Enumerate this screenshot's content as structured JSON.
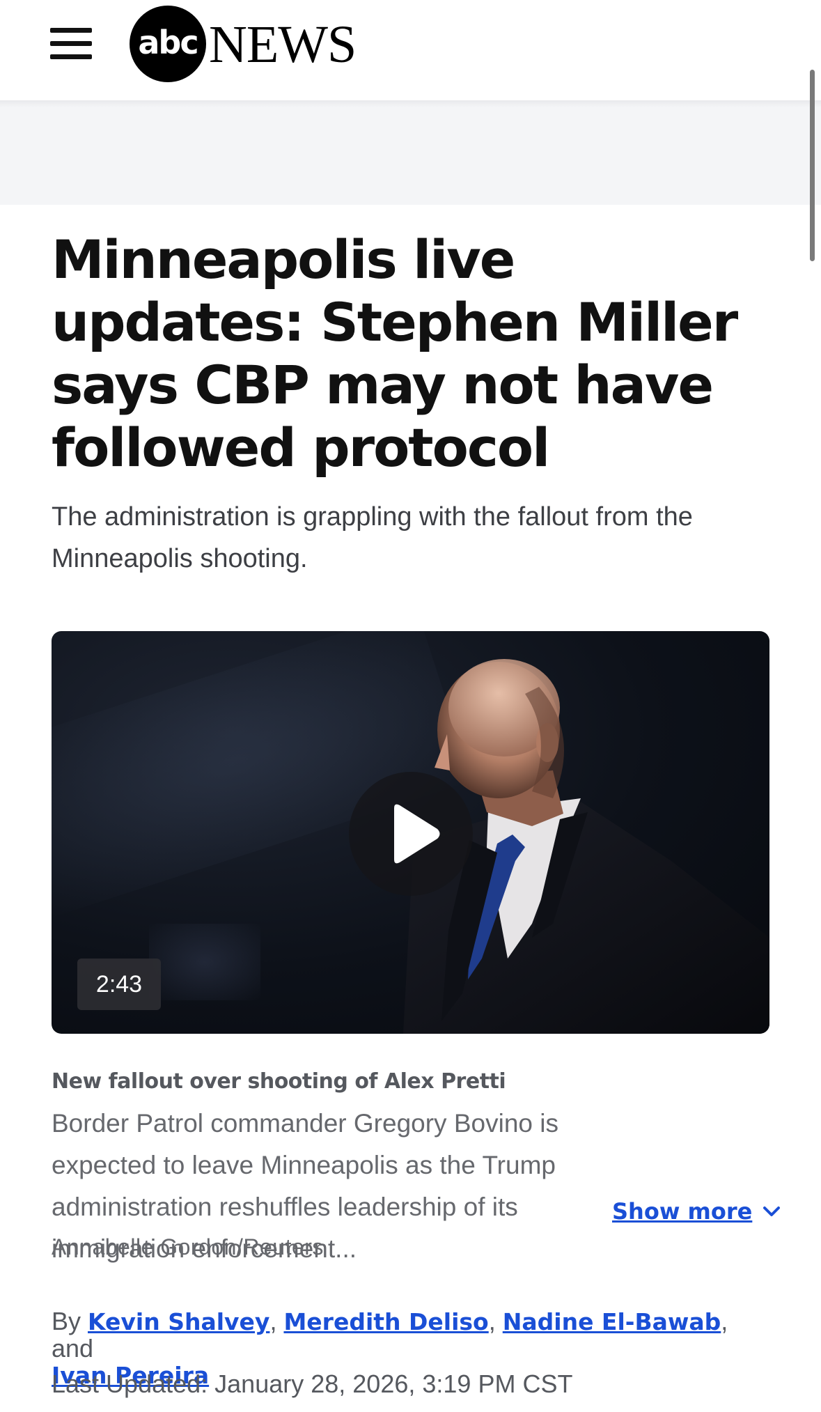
{
  "header": {
    "logo_text": "abc",
    "logo_news": "NEWS"
  },
  "article": {
    "headline": "Minneapolis live updates: Stephen Miller says CBP may not have followed protocol",
    "subheadline": "The administration is grappling with the fallout from the Minneapolis shooting."
  },
  "video": {
    "duration": "2:43",
    "caption_label": "New fallout over shooting of Alex Pretti",
    "caption_text": "Border Patrol commander Gregory Bovino is expected to leave Minneapolis as the Trump administration reshuffles leadership of its immigration enforcement...",
    "show_more_label": "Show more",
    "photo_credit": "Annabelle Gordon/Reuters"
  },
  "byline": {
    "prefix": "By ",
    "authors": [
      "Kevin Shalvey",
      "Meredith Deliso",
      "Nadine El-Bawab",
      "Ivan Pereira"
    ],
    "sep1": ", ",
    "sep2": ", ",
    "sep3": ", and ",
    "last_updated": "Last Updated: January 28, 2026, 3:19 PM CST"
  },
  "colors": {
    "link": "#1a4fd6",
    "ad_band": "#f4f5f7",
    "text": "#1a1a1a"
  }
}
